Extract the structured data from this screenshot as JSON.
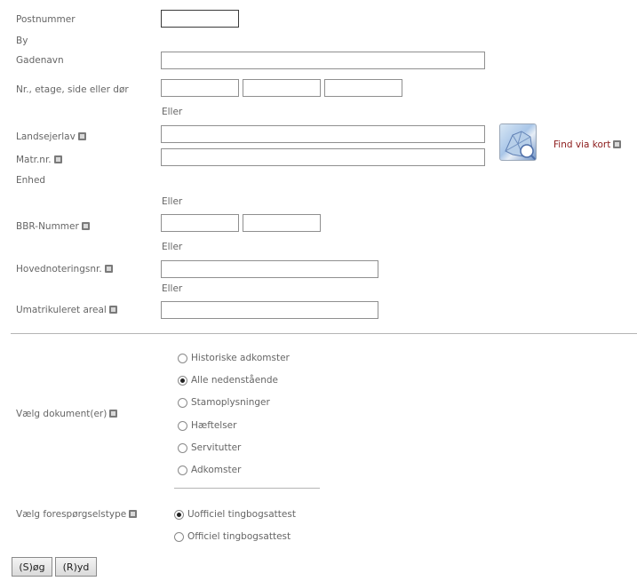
{
  "labels": {
    "postnummer": "Postnummer",
    "by": "By",
    "gadenavn": "Gadenavn",
    "nr_etage": "Nr., etage, side eller dør",
    "landsejerlav": "Landsejerlav",
    "matrnr": "Matr.nr.",
    "enhed": "Enhed",
    "bbr": "BBR-Nummer",
    "hovednotering": "Hovednoteringsnr.",
    "umatrikuleret": "Umatrikuleret areal",
    "vaelg_dokument": "Vælg dokument(er)",
    "vaelg_forespoergsel": "Vælg forespørgselstype"
  },
  "eller": "Eller",
  "find_via_kort": "Find via kort",
  "fields": {
    "postnummer": "",
    "gadenavn": "",
    "nr": "",
    "etage": "",
    "side": "",
    "landsejerlav": "",
    "matrnr": "",
    "bbr1": "",
    "bbr2": "",
    "hovednotering": "",
    "umatrikuleret": ""
  },
  "documents": [
    {
      "label": "Historiske adkomster",
      "checked": false
    },
    {
      "label": "Alle nedenstående",
      "checked": true
    },
    {
      "label": "Stamoplysninger",
      "checked": false
    },
    {
      "label": "Hæftelser",
      "checked": false
    },
    {
      "label": "Servitutter",
      "checked": false
    },
    {
      "label": "Adkomster",
      "checked": false
    }
  ],
  "request_types": [
    {
      "label": "Uofficiel tingbogsattest",
      "checked": true
    },
    {
      "label": "Officiel tingbogsattest",
      "checked": false
    }
  ],
  "buttons": {
    "search": "(S)øg",
    "clear": "(R)yd"
  }
}
